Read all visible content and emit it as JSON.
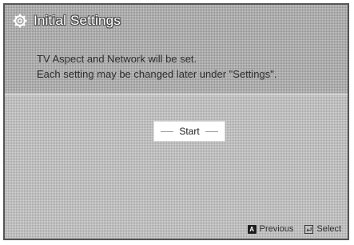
{
  "header": {
    "title": "Initial Settings",
    "title_icon": "gear-icon"
  },
  "description": {
    "line1": "TV Aspect and Network will be set.",
    "line2": "Each setting may be changed later under \"Settings\"."
  },
  "start_button": {
    "label": "Start"
  },
  "footer": {
    "previous": {
      "key": "A",
      "label": "Previous"
    },
    "select": {
      "icon": "enter-icon",
      "label": "Select"
    }
  }
}
